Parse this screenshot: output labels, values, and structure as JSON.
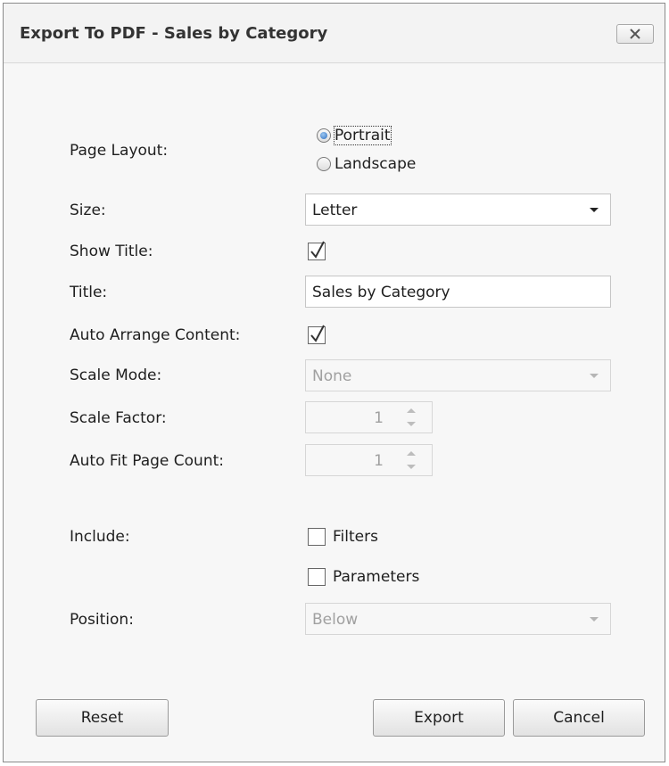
{
  "dialog": {
    "title": "Export To PDF - Sales by Category",
    "close_icon": "close-icon"
  },
  "form": {
    "page_layout_label": "Page Layout:",
    "portrait_label": "Portrait",
    "landscape_label": "Landscape",
    "page_layout_selected": "Portrait",
    "size_label": "Size:",
    "size_value": "Letter",
    "show_title_label": "Show Title:",
    "show_title_checked": true,
    "title_label": "Title:",
    "title_value": "Sales by Category",
    "auto_arrange_label": "Auto Arrange Content:",
    "auto_arrange_checked": true,
    "scale_mode_label": "Scale Mode:",
    "scale_mode_value": "None",
    "scale_factor_label": "Scale Factor:",
    "scale_factor_value": "1",
    "auto_fit_label": "Auto Fit Page Count:",
    "auto_fit_value": "1",
    "include_label": "Include:",
    "filters_label": "Filters",
    "filters_checked": false,
    "parameters_label": "Parameters",
    "parameters_checked": false,
    "position_label": "Position:",
    "position_value": "Below"
  },
  "buttons": {
    "reset": "Reset",
    "export": "Export",
    "cancel": "Cancel"
  },
  "colors": {
    "radio_selected": "#2f6fc0",
    "disabled_text": "#a0a0a0"
  }
}
